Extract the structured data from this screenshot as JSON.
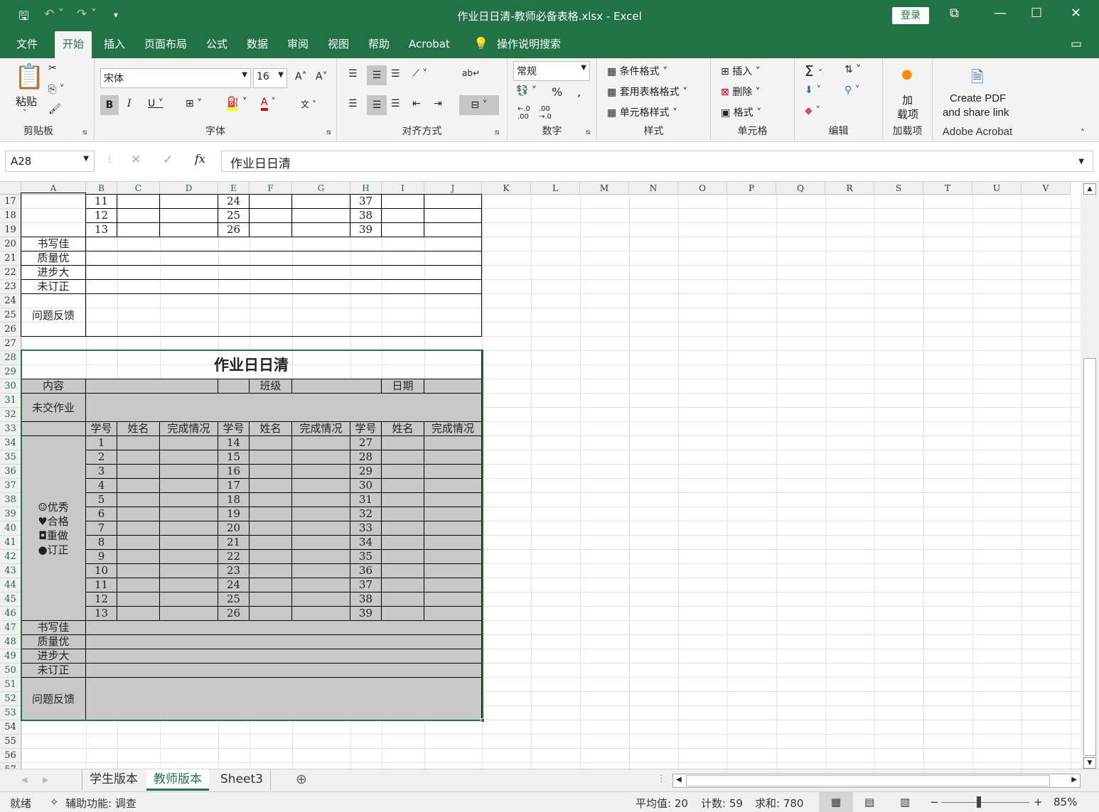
{
  "window": {
    "title": "作业日日清-教师必备表格.xlsx  -  Excel",
    "login": "登录"
  },
  "tabs": [
    "文件",
    "开始",
    "插入",
    "页面布局",
    "公式",
    "数据",
    "审阅",
    "视图",
    "帮助",
    "Acrobat",
    "操作说明搜索"
  ],
  "ribbon": {
    "paste": "粘贴",
    "clipboard": "剪贴板",
    "font_name": "宋体",
    "font_size": "16",
    "font": "字体",
    "align": "对齐方式",
    "number_format": "常规",
    "number": "数字",
    "cond_format": "条件格式",
    "table_format": "套用表格格式",
    "cell_style": "单元格样式",
    "styles": "样式",
    "insert": "插入",
    "delete": "删除",
    "format": "格式",
    "cells": "单元格",
    "editing": "编辑",
    "addin_top": "加",
    "addin_bottom": "载项",
    "addins": "加载项",
    "pdf1": "Create PDF",
    "pdf2": "and share link",
    "acrobat": "Adobe Acrobat"
  },
  "formula": {
    "name_box": "A28",
    "fx": "fx",
    "value": "作业日日清"
  },
  "columns": [
    "A",
    "B",
    "C",
    "D",
    "E",
    "F",
    "G",
    "H",
    "I",
    "J",
    "K",
    "L",
    "M",
    "N",
    "O",
    "P",
    "Q",
    "R",
    "S",
    "T",
    "U",
    "V"
  ],
  "rows": [
    "17",
    "18",
    "19",
    "20",
    "21",
    "22",
    "23",
    "24",
    "25",
    "26",
    "27",
    "28",
    "29",
    "30",
    "31",
    "32",
    "33",
    "34",
    "35",
    "36",
    "37",
    "38",
    "39",
    "40",
    "41",
    "42",
    "43",
    "44",
    "45",
    "46",
    "47",
    "48",
    "49",
    "50",
    "51",
    "52",
    "53",
    "54",
    "55",
    "56",
    "57"
  ],
  "upper": {
    "nums": [
      [
        "11",
        "24",
        "37"
      ],
      [
        "12",
        "25",
        "38"
      ],
      [
        "13",
        "26",
        "39"
      ]
    ],
    "labels": [
      "书写佳",
      "质量优",
      "进步大",
      "未订正"
    ],
    "feedback": "问题反馈"
  },
  "lower": {
    "title": "作业日日清",
    "content": "内容",
    "class": "班级",
    "date": "日期",
    "missing": "未交作业",
    "headers": [
      "学号",
      "姓名",
      "完成情况",
      "学号",
      "姓名",
      "完成情况",
      "学号",
      "姓名",
      "完成情况"
    ],
    "legend": [
      "☺优秀",
      "♥合格",
      "◘重做",
      "●订正"
    ],
    "nums": [
      [
        "1",
        "14",
        "27"
      ],
      [
        "2",
        "15",
        "28"
      ],
      [
        "3",
        "16",
        "29"
      ],
      [
        "4",
        "17",
        "30"
      ],
      [
        "5",
        "18",
        "31"
      ],
      [
        "6",
        "19",
        "32"
      ],
      [
        "7",
        "20",
        "33"
      ],
      [
        "8",
        "21",
        "34"
      ],
      [
        "9",
        "22",
        "35"
      ],
      [
        "10",
        "23",
        "36"
      ],
      [
        "11",
        "24",
        "37"
      ],
      [
        "12",
        "25",
        "38"
      ],
      [
        "13",
        "26",
        "39"
      ]
    ],
    "labels": [
      "书写佳",
      "质量优",
      "进步大",
      "未订正"
    ],
    "feedback": "问题反馈"
  },
  "sheets": [
    "学生版本",
    "教师版本",
    "Sheet3"
  ],
  "status": {
    "ready": "就绪",
    "access": "辅助功能: 调查",
    "avg": "平均值: 20",
    "count": "计数: 59",
    "sum": "求和: 780",
    "zoom": "85%"
  }
}
